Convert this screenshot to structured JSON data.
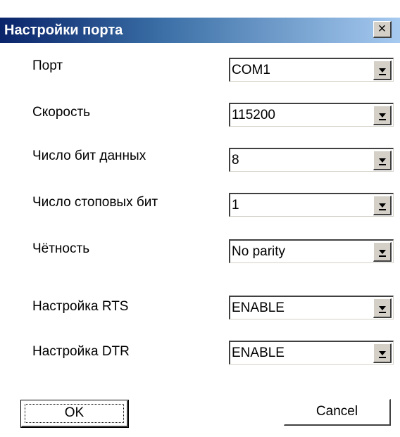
{
  "window": {
    "title": "Настройки порта",
    "close_label": "×"
  },
  "fields": [
    {
      "label": "Порт",
      "value": "COM1"
    },
    {
      "label": "Скорость",
      "value": "115200"
    },
    {
      "label": "Число бит данных",
      "value": "8"
    },
    {
      "label": "Число стоповых бит",
      "value": "1"
    },
    {
      "label": "Чётность",
      "value": "No parity"
    },
    {
      "label": "Настройка RTS",
      "value": "ENABLE"
    },
    {
      "label": "Настройка DTR",
      "value": "ENABLE"
    }
  ],
  "buttons": {
    "ok_label": "OK",
    "cancel_label": "Cancel"
  },
  "icons": {
    "close": "close-icon",
    "dropdown": "chevron-down-icon"
  },
  "colors": {
    "titlebar_start": "#0a246a",
    "titlebar_end": "#a6caf0",
    "button_face": "#d4d0c8"
  }
}
